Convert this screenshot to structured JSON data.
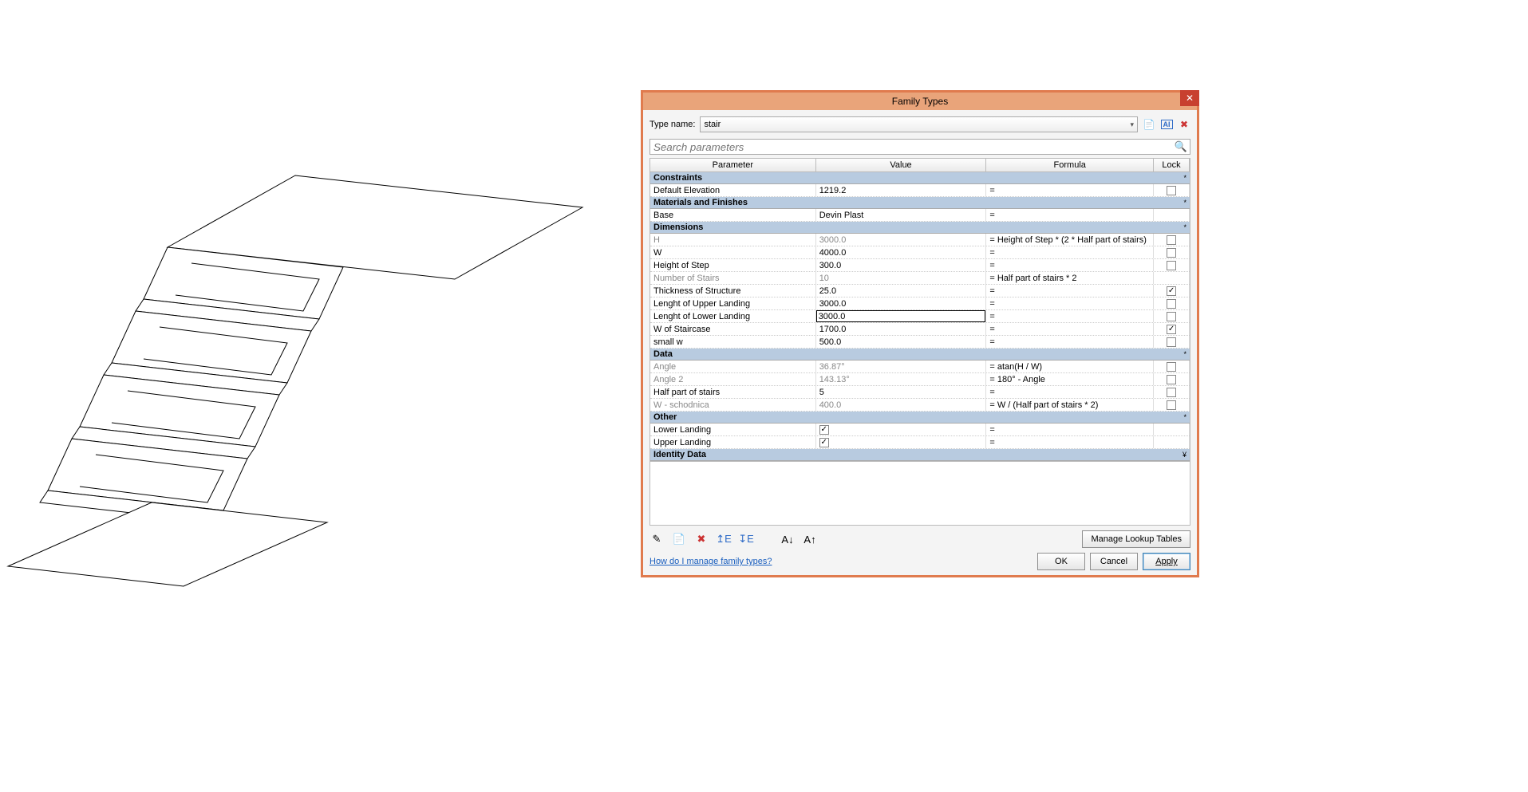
{
  "dialog": {
    "title": "Family Types",
    "typename_label": "Type name:",
    "typename_value": "stair",
    "search_placeholder": "Search parameters",
    "headers": {
      "parameter": "Parameter",
      "value": "Value",
      "formula": "Formula",
      "lock": "Lock"
    },
    "groups": [
      {
        "name": "Constraints",
        "rows": [
          {
            "param": "Default Elevation",
            "value": "1219.2",
            "formula": "=",
            "lock": false,
            "readonly": false
          }
        ]
      },
      {
        "name": "Materials and Finishes",
        "rows": [
          {
            "param": "Base",
            "value": "Devin Plast",
            "formula": "=",
            "lock": null,
            "readonly": false
          }
        ]
      },
      {
        "name": "Dimensions",
        "rows": [
          {
            "param": "H",
            "value": "3000.0",
            "formula": "= Height of Step * (2 * Half part of stairs)",
            "lock": false,
            "readonly": true
          },
          {
            "param": "W",
            "value": "4000.0",
            "formula": "=",
            "lock": false,
            "readonly": false
          },
          {
            "param": "Height of Step",
            "value": "300.0",
            "formula": "=",
            "lock": false,
            "readonly": false
          },
          {
            "param": "Number of Stairs",
            "value": "10",
            "formula": "= Half part of stairs * 2",
            "lock": null,
            "readonly": true
          },
          {
            "param": "Thickness of Structure",
            "value": "25.0",
            "formula": "=",
            "lock": true,
            "readonly": false
          },
          {
            "param": "Lenght of Upper Landing",
            "value": "3000.0",
            "formula": "=",
            "lock": false,
            "readonly": false
          },
          {
            "param": "Lenght of Lower Landing",
            "value": "3000.0",
            "formula": "=",
            "lock": false,
            "readonly": false,
            "editing": true
          },
          {
            "param": "W of Staircase",
            "value": "1700.0",
            "formula": "=",
            "lock": true,
            "readonly": false
          },
          {
            "param": "small w",
            "value": "500.0",
            "formula": "=",
            "lock": false,
            "readonly": false
          }
        ]
      },
      {
        "name": "Data",
        "rows": [
          {
            "param": "Angle",
            "value": "36.87°",
            "formula": "= atan(H / W)",
            "lock": false,
            "readonly": true
          },
          {
            "param": "Angle 2",
            "value": "143.13°",
            "formula": "= 180° - Angle",
            "lock": false,
            "readonly": true
          },
          {
            "param": "Half part of stairs",
            "value": "5",
            "formula": "=",
            "lock": false,
            "readonly": false
          },
          {
            "param": "W - schodnica",
            "value": "400.0",
            "formula": "= W / (Half part of stairs * 2)",
            "lock": false,
            "readonly": true
          }
        ]
      },
      {
        "name": "Other",
        "rows": [
          {
            "param": "Lower Landing",
            "value_check": true,
            "formula": "=",
            "lock": null,
            "readonly": false
          },
          {
            "param": "Upper Landing",
            "value_check": true,
            "formula": "=",
            "lock": null,
            "readonly": false
          }
        ]
      },
      {
        "name": "Identity Data",
        "collapsed": true,
        "rows": []
      }
    ],
    "manage_lookup": "Manage Lookup Tables",
    "help_link": "How do I manage family types?",
    "ok": "OK",
    "cancel": "Cancel",
    "apply": "Apply",
    "icons": {
      "new_type": "new-type-icon",
      "rename_type": "rename-type-icon",
      "delete_type": "delete-type-icon",
      "pencil": "pencil-icon",
      "new_param": "new-param-icon",
      "delete_param": "delete-param-icon",
      "move_up": "move-up-icon",
      "move_down": "move-down-icon",
      "sort_asc": "sort-asc-icon",
      "sort_desc": "sort-desc-icon"
    }
  }
}
